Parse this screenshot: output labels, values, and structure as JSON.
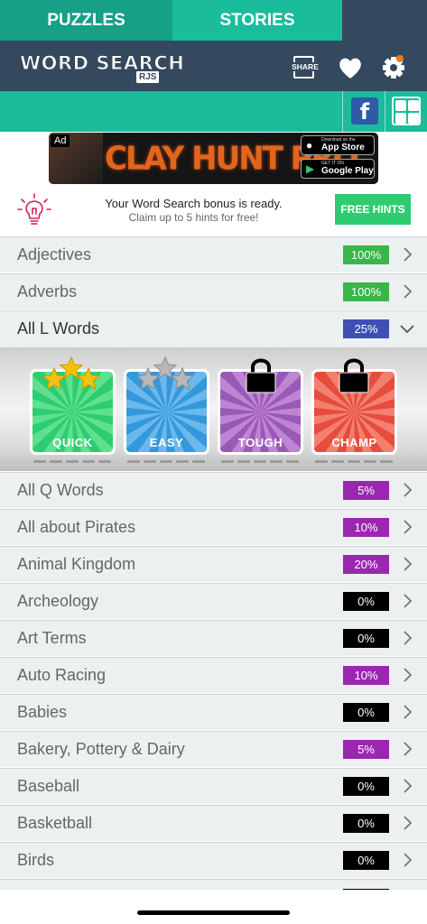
{
  "header": {
    "logo_text": "WORD SEARCH",
    "logo_sub": "RJS",
    "share_label": "SHARE",
    "icons": [
      "share-icon",
      "heart-icon",
      "gear-icon"
    ]
  },
  "tabs": [
    {
      "label": "PUZZLES",
      "active": true
    },
    {
      "label": "STORIES",
      "active": false
    }
  ],
  "social": {
    "facebook_glyph": "f"
  },
  "ad": {
    "tag": "Ad",
    "title": "CLAY HUNT PRO",
    "appstore_small": "Download on the",
    "appstore_big": "App Store",
    "gplay_small": "GET IT ON",
    "gplay_big": "Google Play"
  },
  "bonus": {
    "title": "Your Word Search bonus is ready.",
    "subtitle": "Claim up to 5 hints for free!",
    "button": "FREE HINTS"
  },
  "colors": {
    "header": "#34495e",
    "tab_active": "#16a085",
    "tab_inactive": "#1abc9c",
    "green": "#3ab54a",
    "blue": "#3f4fb5",
    "purple": "#9b27b0",
    "black": "#000000",
    "quick": "#2ecc71",
    "easy": "#3498db",
    "tough": "#9b59b6",
    "champ": "#e74c3c"
  },
  "categories_top": [
    {
      "name": "Adjectives",
      "percent": "100%",
      "badge": "green"
    },
    {
      "name": "Adverbs",
      "percent": "100%",
      "badge": "green"
    },
    {
      "name": "All L Words",
      "percent": "25%",
      "badge": "blue",
      "expanded": true
    }
  ],
  "levels": [
    {
      "label": "QUICK",
      "stars": 3,
      "stars_gold": 3,
      "locked": false
    },
    {
      "label": "EASY",
      "stars": 3,
      "stars_gold": 0,
      "locked": false
    },
    {
      "label": "TOUGH",
      "locked": true
    },
    {
      "label": "CHAMP",
      "locked": true
    }
  ],
  "categories": [
    {
      "name": "All Q Words",
      "percent": "5%",
      "badge": "purple"
    },
    {
      "name": "All about Pirates",
      "percent": "10%",
      "badge": "purple"
    },
    {
      "name": "Animal Kingdom",
      "percent": "20%",
      "badge": "purple"
    },
    {
      "name": "Archeology",
      "percent": "0%",
      "badge": "black"
    },
    {
      "name": "Art Terms",
      "percent": "0%",
      "badge": "black"
    },
    {
      "name": "Auto Racing",
      "percent": "10%",
      "badge": "purple"
    },
    {
      "name": "Babies",
      "percent": "0%",
      "badge": "black"
    },
    {
      "name": "Bakery, Pottery & Dairy",
      "percent": "5%",
      "badge": "purple"
    },
    {
      "name": "Baseball",
      "percent": "0%",
      "badge": "black"
    },
    {
      "name": "Basketball",
      "percent": "0%",
      "badge": "black"
    },
    {
      "name": "Birds",
      "percent": "0%",
      "badge": "black"
    }
  ]
}
